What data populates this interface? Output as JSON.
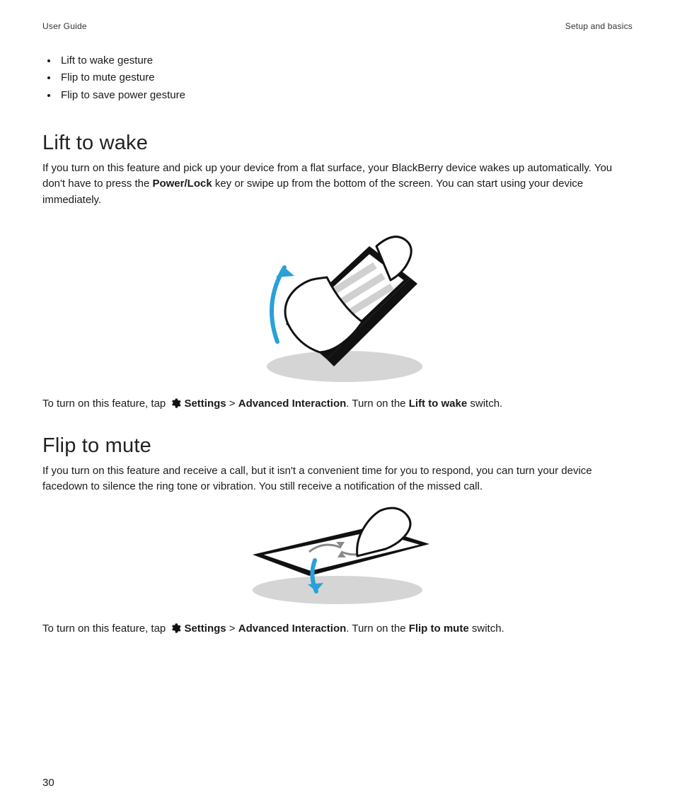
{
  "header": {
    "left": "User Guide",
    "right": "Setup and basics"
  },
  "bullets": [
    "Lift to wake gesture",
    "Flip to mute gesture",
    "Flip to save power gesture"
  ],
  "sections": {
    "lift": {
      "heading": "Lift to wake",
      "para_a": "If you turn on this feature and pick up your device from a flat surface, your BlackBerry device wakes up automatically. You don't have to press the ",
      "para_bold": "Power/Lock",
      "para_b": " key or swipe up from the bottom of the screen. You can start using your device immediately.",
      "instr_a": "To turn on this feature, tap ",
      "instr_settings": "Settings",
      "instr_sep": " > ",
      "instr_adv": "Advanced Interaction",
      "instr_b": ". Turn on the ",
      "instr_switch": "Lift to wake",
      "instr_c": " switch."
    },
    "flip": {
      "heading": "Flip to mute",
      "para": "If you turn on this feature and receive a call, but it isn't a convenient time for you to respond, you can turn your device facedown to silence the ring tone or vibration. You still receive a notification of the missed call.",
      "instr_a": "To turn on this feature, tap ",
      "instr_settings": "Settings",
      "instr_sep": " > ",
      "instr_adv": "Advanced Interaction",
      "instr_b": ". Turn on the ",
      "instr_switch": "Flip to mute",
      "instr_c": " switch."
    }
  },
  "page_number": "30"
}
